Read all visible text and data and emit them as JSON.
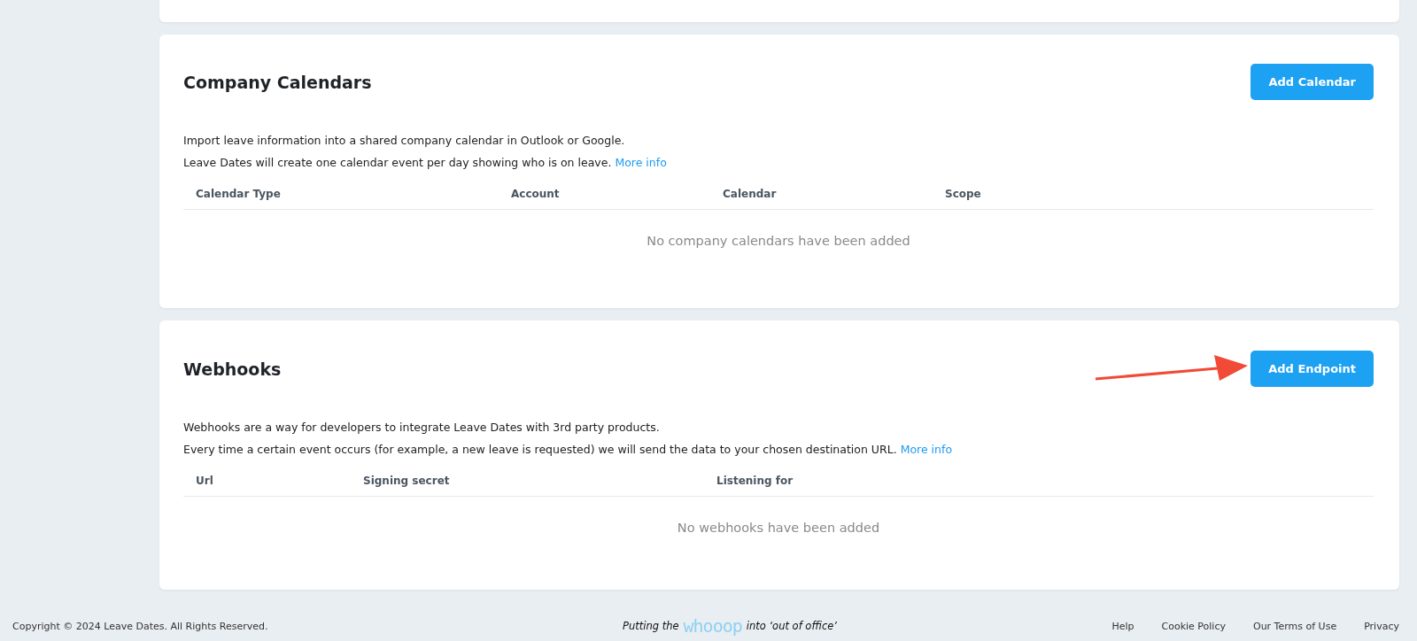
{
  "sections": [
    {
      "title": "Company Calendars",
      "button": "Add Calendar",
      "annotated": false,
      "lines": [
        "Import leave information into a shared company calendar in Outlook or Google.",
        "Leave Dates will create one calendar event per day showing who is on leave."
      ],
      "link": "More info",
      "columns": [
        "Calendar Type",
        "Account",
        "Calendar",
        "Scope"
      ],
      "empty": "No company calendars have been added"
    },
    {
      "title": "Webhooks",
      "button": "Add Endpoint",
      "annotated": true,
      "lines": [
        "Webhooks are a way for developers to integrate Leave Dates with 3rd party products.",
        "Every time a certain event occurs (for example, a new leave is requested) we will send the data to your chosen destination URL."
      ],
      "link": "More info",
      "columns": [
        "Url",
        "Signing secret",
        "Listening for"
      ],
      "empty": "No webhooks have been added"
    }
  ],
  "footer": {
    "copyright": "Copyright © 2024 Leave Dates. All Rights Reserved.",
    "tagline_before": "Putting the",
    "tagline_logo": "whooop",
    "tagline_after": "into ‘out of office’",
    "links": [
      "Help",
      "Cookie Policy",
      "Our Terms of Use",
      "Privacy"
    ]
  }
}
